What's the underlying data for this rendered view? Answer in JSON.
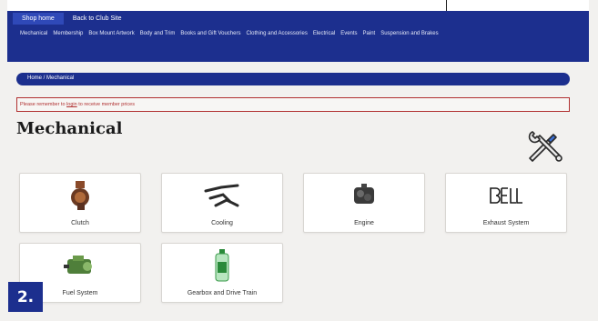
{
  "header": {
    "tabs": [
      {
        "label": "Shop home",
        "active": true
      },
      {
        "label": "Back to Club Site",
        "active": false
      }
    ],
    "nav_items": [
      "Mechanical",
      "Membership",
      "Box Mount Artwork",
      "Body and Trim",
      "Books and Gift Vouchers",
      "Clothing and Accessories",
      "Electrical",
      "Events",
      "Paint",
      "Suspension and Brakes"
    ]
  },
  "breadcrumb": "Home / Mechanical",
  "notice": {
    "prefix": "Please remember to ",
    "link": "login",
    "suffix": " to receive member prices"
  },
  "page_title": "Mechanical",
  "categories": [
    {
      "label": "Clutch",
      "icon": "clutch-icon"
    },
    {
      "label": "Cooling",
      "icon": "hoses-icon"
    },
    {
      "label": "Engine",
      "icon": "engine-icon"
    },
    {
      "label": "Exhaust System",
      "icon": "bell-logo-icon"
    },
    {
      "label": "Fuel System",
      "icon": "fuel-pump-icon"
    },
    {
      "label": "Gearbox and Drive Train",
      "icon": "oil-bottle-icon"
    }
  ],
  "badge": "2.",
  "colors": {
    "brand": "#1c2f8e",
    "notice": "#b03030"
  }
}
